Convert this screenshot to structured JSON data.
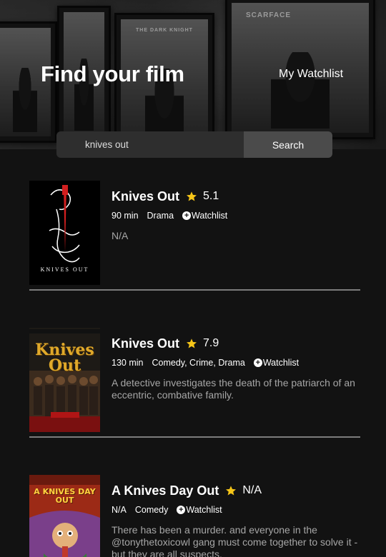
{
  "header": {
    "title": "Find your film",
    "watchlist_link": "My Watchlist",
    "backdrop_poster_texts": [
      "THE DARK KNIGHT",
      "SCARFACE"
    ]
  },
  "search": {
    "value": "knives out",
    "placeholder": "",
    "button_label": "Search"
  },
  "colors": {
    "background": "#121212",
    "star": "#f5c518",
    "plot_text": "#a6a6a6",
    "divider": "#7c7c7c",
    "search_input": "#2e2e2e",
    "search_button": "#4b4b4b"
  },
  "results": [
    {
      "title": "Knives Out",
      "rating": "5.1",
      "runtime": "90 min",
      "genre": "Drama",
      "watchlist_label": "Watchlist",
      "plot": "N/A",
      "poster_text": "KNIVES OUT"
    },
    {
      "title": "Knives Out",
      "rating": "7.9",
      "runtime": "130 min",
      "genre": "Comedy, Crime, Drama",
      "watchlist_label": "Watchlist",
      "plot": "A detective investigates the death of the patriarch of an eccentric, combative family.",
      "poster_text": "Knives Out"
    },
    {
      "title": "A Knives Day Out",
      "rating": "N/A",
      "runtime": "N/A",
      "genre": "Comedy",
      "watchlist_label": "Watchlist",
      "plot": "There has been a murder. and everyone in the @tonythetoxicowl gang must come together to solve it - but they are all suspects.",
      "poster_text": "A KNIVES DAY OUT"
    }
  ]
}
